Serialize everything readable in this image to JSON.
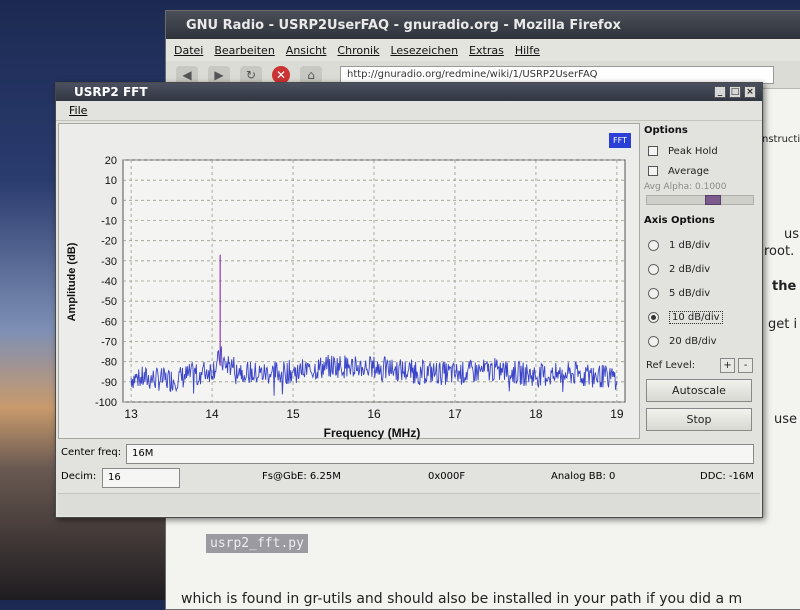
{
  "firefox": {
    "title": "GNU Radio - USRP2UserFAQ - gnuradio.org - Mozilla Firefox",
    "menu": [
      "Datei",
      "Bearbeiten",
      "Ansicht",
      "Chronik",
      "Lesezeichen",
      "Extras",
      "Hilfe"
    ],
    "url": "http://gnuradio.org/redmine/wiki/1/USRP2UserFAQ",
    "fragments": [
      "nstructi",
      "usua",
      "root.",
      "the",
      "get i",
      "use"
    ],
    "code_snippet": "usrp2_fft.py",
    "paragraph": "which is found in gr-utils and should also be installed in your path if you did a m"
  },
  "fft_window": {
    "title": "USRP2 FFT",
    "menu_file": "File",
    "fft_badge": "FFT",
    "options": {
      "header": "Options",
      "peak_hold": "Peak Hold",
      "average": "Average",
      "avg_alpha_label": "Avg Alpha: 0.1000",
      "avg_alpha_value": 0.1
    },
    "axis_options": {
      "header": "Axis Options",
      "choices": [
        "1 dB/div",
        "2 dB/div",
        "5 dB/div",
        "10 dB/div",
        "20 dB/div"
      ],
      "selected": "10 dB/div",
      "ref_level_label": "Ref Level:",
      "plus": "+",
      "minus": "-",
      "autoscale": "Autoscale",
      "stop": "Stop"
    },
    "center_freq_label": "Center freq:",
    "center_freq_value": "16M",
    "decim_label": "Decim:",
    "decim_value": "16",
    "fs_label": "Fs@GbE: 6.25M",
    "hex_label": "0x000F",
    "analog_bb": "Analog BB: 0",
    "ddc": "DDC: -16M"
  },
  "chart_data": {
    "type": "line",
    "title": "",
    "xlabel": "Frequency (MHz)",
    "ylabel": "Amplitude (dB)",
    "xlim": [
      12.9,
      19.1
    ],
    "ylim": [
      -100,
      20
    ],
    "xticks": [
      13,
      14,
      15,
      16,
      17,
      18,
      19
    ],
    "yticks": [
      20,
      10,
      0,
      -10,
      -20,
      -30,
      -40,
      -50,
      -60,
      -70,
      -80,
      -90,
      -100
    ],
    "grid": true,
    "series": [
      {
        "color": "#3a44c8",
        "noise_floor_db": -88,
        "x": [
          13.0,
          13.5,
          14.0,
          14.08,
          14.1,
          14.12,
          14.5,
          15.0,
          15.5,
          16.0,
          16.5,
          17.0,
          17.5,
          18.0,
          18.5,
          19.0
        ],
        "y": [
          -88,
          -89,
          -84,
          -80,
          -27,
          -80,
          -86,
          -85,
          -82,
          -83,
          -85,
          -86,
          -84,
          -87,
          -86,
          -88
        ]
      }
    ],
    "peak": {
      "x": 14.1,
      "y": -27
    }
  }
}
